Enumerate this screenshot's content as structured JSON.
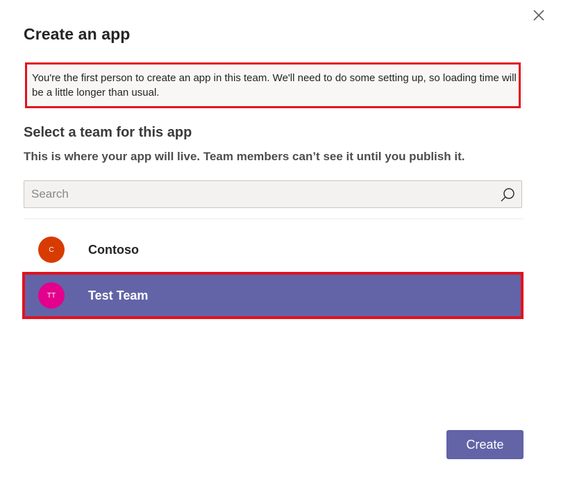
{
  "dialog": {
    "title": "Create an app",
    "notice": "You're the first person to create an app in this team. We'll need to do some setting up, so loading time will be a little longer than usual.",
    "close_icon": "close-icon"
  },
  "team_section": {
    "title": "Select a team for this app",
    "description": "This is where your app will live. Team members can’t see it until you publish it."
  },
  "search": {
    "placeholder": "Search",
    "value": "",
    "icon": "search-icon"
  },
  "teams": [
    {
      "initials": "C",
      "name": "Contoso",
      "avatar_color": "#d83b01",
      "selected": false
    },
    {
      "initials": "TT",
      "name": "Test Team",
      "avatar_color": "#e3008c",
      "selected": true
    }
  ],
  "actions": {
    "create_label": "Create"
  },
  "colors": {
    "accent": "#6264a7",
    "highlight": "#e3111f"
  }
}
